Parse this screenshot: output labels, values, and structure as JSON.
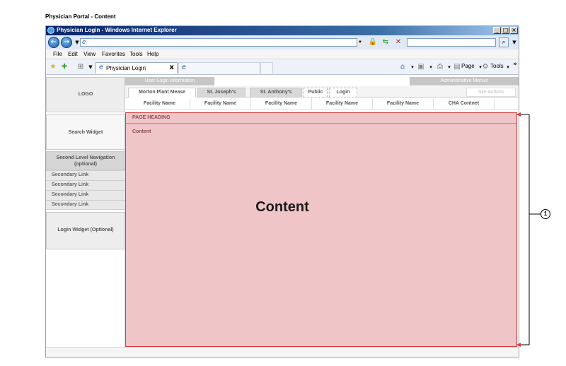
{
  "doc_title": "Physician Portal - Content",
  "browser": {
    "window_title": "Physician Login - Windows Internet Explorer",
    "address_icon": "e",
    "menu": [
      "File",
      "Edit",
      "View",
      "Favorites",
      "Tools",
      "Help"
    ],
    "tab_label": "Physician Login",
    "tab_close": "x",
    "command_page": "Page",
    "command_tools": "Tools"
  },
  "portal": {
    "logo": "LOGO",
    "user_login_info": "User Login Information",
    "admin_menus": "Administrative Menus",
    "site_actions": "Site Actions",
    "nav_tabs": [
      {
        "label": "Morton Plant Mease"
      },
      {
        "label": "St. Joseph's"
      },
      {
        "label": "St. Anthony's"
      },
      {
        "label": "Public"
      },
      {
        "label": "Login"
      }
    ],
    "facilities": [
      "Facility Name",
      "Facility Name",
      "Facility Name",
      "Facility Name",
      "Facility Name",
      "CHA Contnet"
    ],
    "search_widget": "Search Widget",
    "second_level_nav": "Second Level Navigation (optional)",
    "secondary_links": [
      "Secondary Link",
      "Secondary Link",
      "Secondary Link",
      "Secondary Link"
    ],
    "login_widget": "Login Widget (Optional)",
    "page_heading": "PAGE HEADING",
    "content_label": "Content",
    "content_big": "Content"
  },
  "callout": {
    "number": "1"
  },
  "colors": {
    "content_bg": "#f0c5c8",
    "content_border": "#d43c3c",
    "title_bar": "#0a246a"
  }
}
